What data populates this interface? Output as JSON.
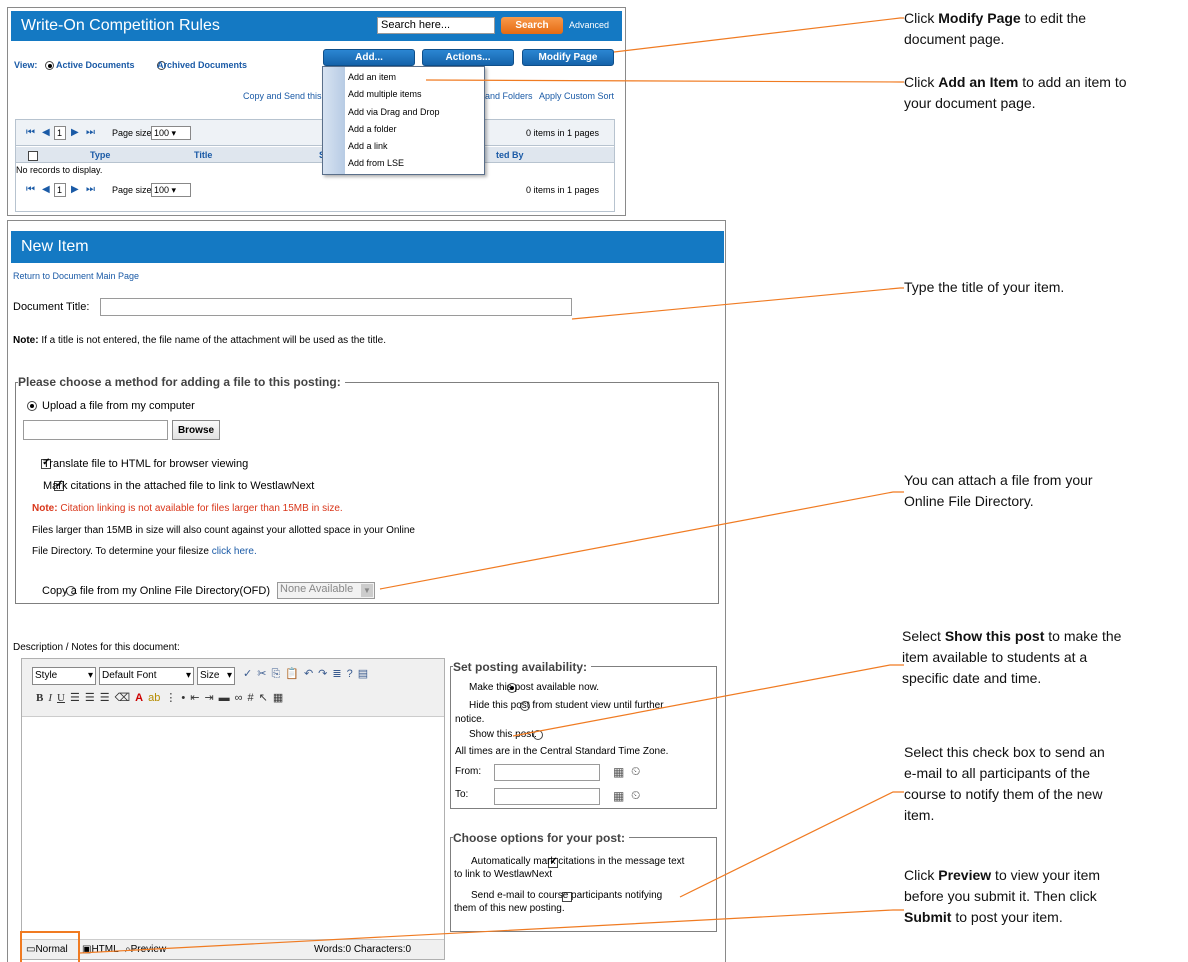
{
  "top": {
    "title": "Write-On Competition Rules",
    "search_placeholder": "Search here...",
    "search_button": "Search",
    "advanced": "Advanced",
    "view_label": "View:",
    "active_docs": "Active Documents",
    "archived_docs": "Archived Documents",
    "add_button": "Add...",
    "actions_button": "Actions...",
    "modify_button": "Modify Page",
    "link_copy": "Copy and Send this p",
    "link_folders": "and Folders",
    "link_sort": "Apply Custom Sort",
    "page_num": "1",
    "page_size_label": "Page size:",
    "page_size": "100",
    "items_info": "0 items in 1 pages",
    "col_type": "Type",
    "col_title": "Title",
    "col_s": "S",
    "col_by": "ted By",
    "no_records": "No records to display.",
    "menu_items": [
      "Add an item",
      "Add multiple items",
      "Add via Drag and Drop",
      "Add a folder",
      "Add a link",
      "Add from LSE"
    ]
  },
  "form": {
    "title": "New Item",
    "return_link": "Return to Document Main Page",
    "doc_title_label": "Document Title:",
    "note_bold": "Note:",
    "note_text": " If a title is not entered, the file name of the attachment will be used as the title.",
    "method_legend": "Please choose a method for adding a file to this posting:",
    "upload_option": "Upload a file from my computer",
    "browse": "Browse",
    "translate": "Translate file to HTML for browser viewing",
    "mark_cites": "Mark citations in the attached file to link to WestlawNext",
    "note2_bold": "Note:",
    "note2_text": " Citation linking is not available for files larger than 15MB in size.",
    "note3": "Files larger than 15MB in size will also count against your allotted space in your Online",
    "note4": "File Directory. To determine your filesize ",
    "click_here": "click here.",
    "copy_option": "Copy a file from my Online File Directory(OFD)",
    "none_available": "None Available",
    "desc_label": "Description / Notes for this document:",
    "tb_style": "Style",
    "tb_font": "Default Font",
    "tb_size": "Size",
    "avail_legend": "Set posting availability:",
    "avail_now": "Make this post available now.",
    "avail_hide": "Hide this post from student view until further",
    "avail_hide2": "notice.",
    "avail_show": "Show this post:",
    "times_note": "All times are in the Central Standard Time Zone.",
    "from": "From:",
    "to": "To:",
    "options_legend": "Choose options for your post:",
    "opt_mark": "Automatically mark citations in the message text",
    "opt_mark2": "to link to WestlawNext",
    "opt_email": "Send e-mail to course participants notifying",
    "opt_email2": "them of this new posting.",
    "mode_normal": "Normal",
    "mode_html": "HTML",
    "mode_preview": "Preview",
    "word_count": "Words:0 Characters:0"
  },
  "annotations": {
    "a1_pre": "Click ",
    "a1_bold": "Modify Page",
    "a1_post": " to edit the",
    "a1_line2": "document page.",
    "a2_pre": "Click ",
    "a2_bold": "Add an Item",
    "a2_post": " to add an item to",
    "a2_line2": "your document page.",
    "a3": "Type the title of your item.",
    "a4_line1": "You can attach a file from your",
    "a4_line2": "Online File Directory.",
    "a5_pre": "Select ",
    "a5_bold": "Show this post",
    "a5_post": " to make the",
    "a5_line2": "item available to students at a",
    "a5_line3": "specific date and time.",
    "a6_line1": "Select this check box to send an",
    "a6_line2": "e-mail to all participants of the",
    "a6_line3": "course to notify them of the new",
    "a6_line4": "item.",
    "a7_pre": "Click ",
    "a7_bold": "Preview",
    "a7_post": " to view your item",
    "a7_line2": "before you submit it. Then click",
    "a7_bold2": "Submit",
    "a7_post2": " to post your item."
  },
  "colors": {
    "accent_blue": "#1479c3",
    "search_orange": "#f0791e",
    "callout_orange": "#f07b22"
  }
}
